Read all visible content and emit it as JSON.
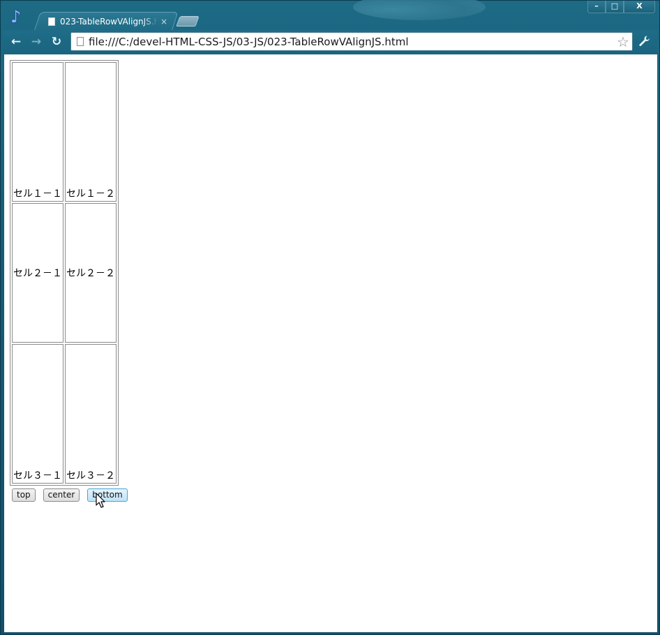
{
  "browser": {
    "tab_title": "023-TableRowVAlignJS.html",
    "tab_close": "×",
    "url": "file:///C:/devel-HTML-CSS-JS/03-JS/023-TableRowVAlignJS.html",
    "window_controls": {
      "minimize": "–",
      "restore": "□",
      "close": "X"
    },
    "nav": {
      "back": "←",
      "forward": "→",
      "reload": "↻"
    },
    "icons": {
      "star": "☆",
      "wrench": "🔧",
      "logo": "♪"
    }
  },
  "page": {
    "table": {
      "rows": [
        {
          "valign": "bottom",
          "cells": [
            "セル１－１",
            "セル１－２"
          ]
        },
        {
          "valign": "middle",
          "cells": [
            "セル２－１",
            "セル２－２"
          ]
        },
        {
          "valign": "bottom",
          "cells": [
            "セル３－１",
            "セル３－２"
          ]
        }
      ]
    },
    "buttons": {
      "top": "top",
      "center": "center",
      "bottom": "bottom"
    }
  },
  "colors": {
    "chrome": "#1d6a85",
    "button_hover": "#bfe3f7"
  }
}
